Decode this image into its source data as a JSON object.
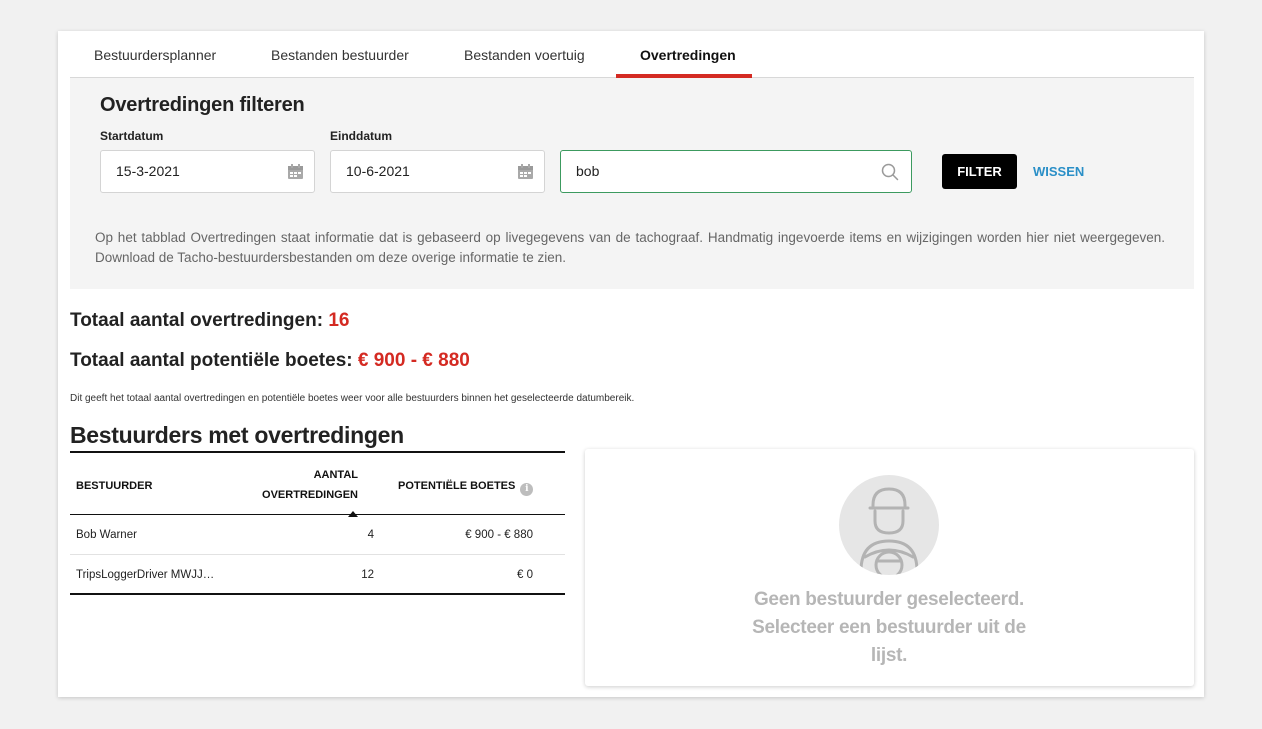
{
  "tabs": [
    {
      "label": "Bestuurdersplanner",
      "active": false
    },
    {
      "label": "Bestanden bestuurder",
      "active": false
    },
    {
      "label": "Bestanden voertuig",
      "active": false
    },
    {
      "label": "Overtredingen",
      "active": true
    }
  ],
  "filter": {
    "title": "Overtredingen filteren",
    "start_label": "Startdatum",
    "start_value": "15-3-2021",
    "end_label": "Einddatum",
    "end_value": "10-6-2021",
    "search_value": "bob",
    "filter_button": "FILTER",
    "clear_link": "WISSEN",
    "info": "Op het tabblad Overtredingen staat informatie dat is gebaseerd op livegegevens van de tachograaf. Handmatig ingevoerde items en wijzigingen worden hier niet weergegeven. Download de Tacho-bestuurdersbestanden om deze overige informatie te zien."
  },
  "totals": {
    "violations_label": "Totaal aantal overtredingen:",
    "violations_value": "16",
    "fines_label": "Totaal aantal potentiële boetes:",
    "fines_value": "€ 900 - € 880",
    "note": "Dit geeft het totaal aantal overtredingen en potentiële boetes weer voor alle bestuurders binnen het geselecteerde datumbereik."
  },
  "drivers": {
    "title": "Bestuurders met overtredingen",
    "columns": {
      "driver": "BESTUURDER",
      "count_line1": "AANTAL",
      "count_line2": "OVERTREDINGEN",
      "fines": "POTENTIËLE BOETES"
    },
    "rows": [
      {
        "driver": "Bob Warner",
        "count": "4",
        "fines": "€ 900 - € 880"
      },
      {
        "driver": "TripsLoggerDriver MWJJ…",
        "count": "12",
        "fines": "€ 0"
      }
    ]
  },
  "detail": {
    "empty_message": "Geen bestuurder geselecteerd. Selecteer een bestuurder uit de lijst."
  },
  "colors": {
    "accent_red": "#d42a22",
    "link_blue": "#2a8fc7",
    "search_border_green": "#3c9a5f"
  },
  "icons": [
    "calendar-icon",
    "search-icon",
    "info-icon",
    "sort-ascending-icon",
    "driver-avatar-icon"
  ]
}
